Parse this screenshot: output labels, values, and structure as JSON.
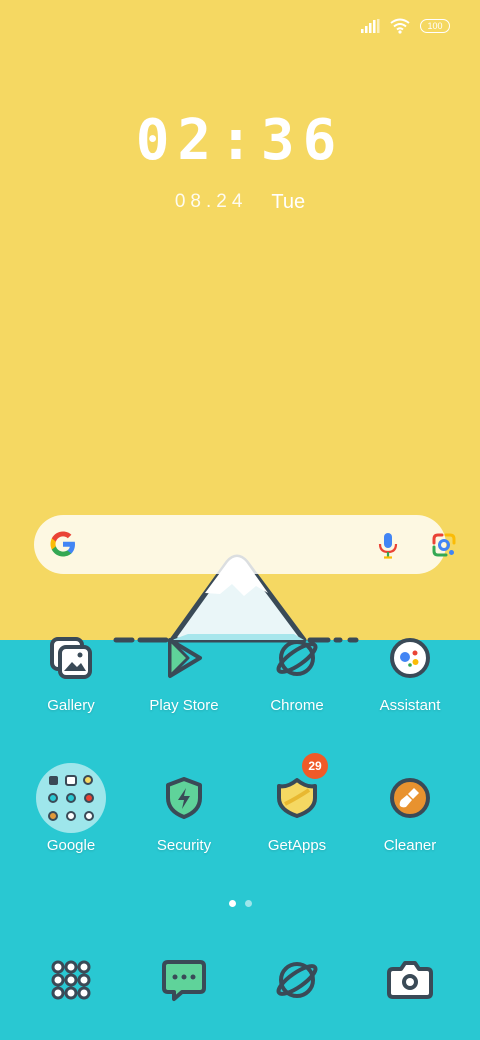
{
  "status_bar": {
    "battery": "100",
    "icons": [
      "signal-icon",
      "wifi-icon",
      "battery-icon"
    ]
  },
  "lockscreen": {
    "time": "02:36",
    "date": "08.24",
    "weekday": "Tue"
  },
  "search_bar": {
    "icons": [
      "google-logo-icon",
      "microphone-icon",
      "google-lens-icon"
    ]
  },
  "apps": [
    {
      "label": "Gallery",
      "icon": "gallery-icon"
    },
    {
      "label": "Play Store",
      "icon": "play-store-icon"
    },
    {
      "label": "Chrome",
      "icon": "chrome-planet-icon"
    },
    {
      "label": "Assistant",
      "icon": "assistant-icon"
    },
    {
      "label": "Google",
      "icon": "folder-icon"
    },
    {
      "label": "Security",
      "icon": "security-shield-icon"
    },
    {
      "label": "GetApps",
      "icon": "getapps-icon",
      "badge": "29"
    },
    {
      "label": "Cleaner",
      "icon": "cleaner-brush-icon"
    }
  ],
  "page_indicator": {
    "pages": 2,
    "current": 1
  },
  "dock": [
    {
      "icon": "app-drawer-icon"
    },
    {
      "icon": "messages-icon"
    },
    {
      "icon": "browser-planet-icon"
    },
    {
      "icon": "camera-icon"
    }
  ],
  "colors": {
    "wallpaper_top": "#f5d862",
    "wallpaper_bottom": "#29c8d2",
    "badge": "#f05a28",
    "icon_stroke": "#3a4a57"
  }
}
